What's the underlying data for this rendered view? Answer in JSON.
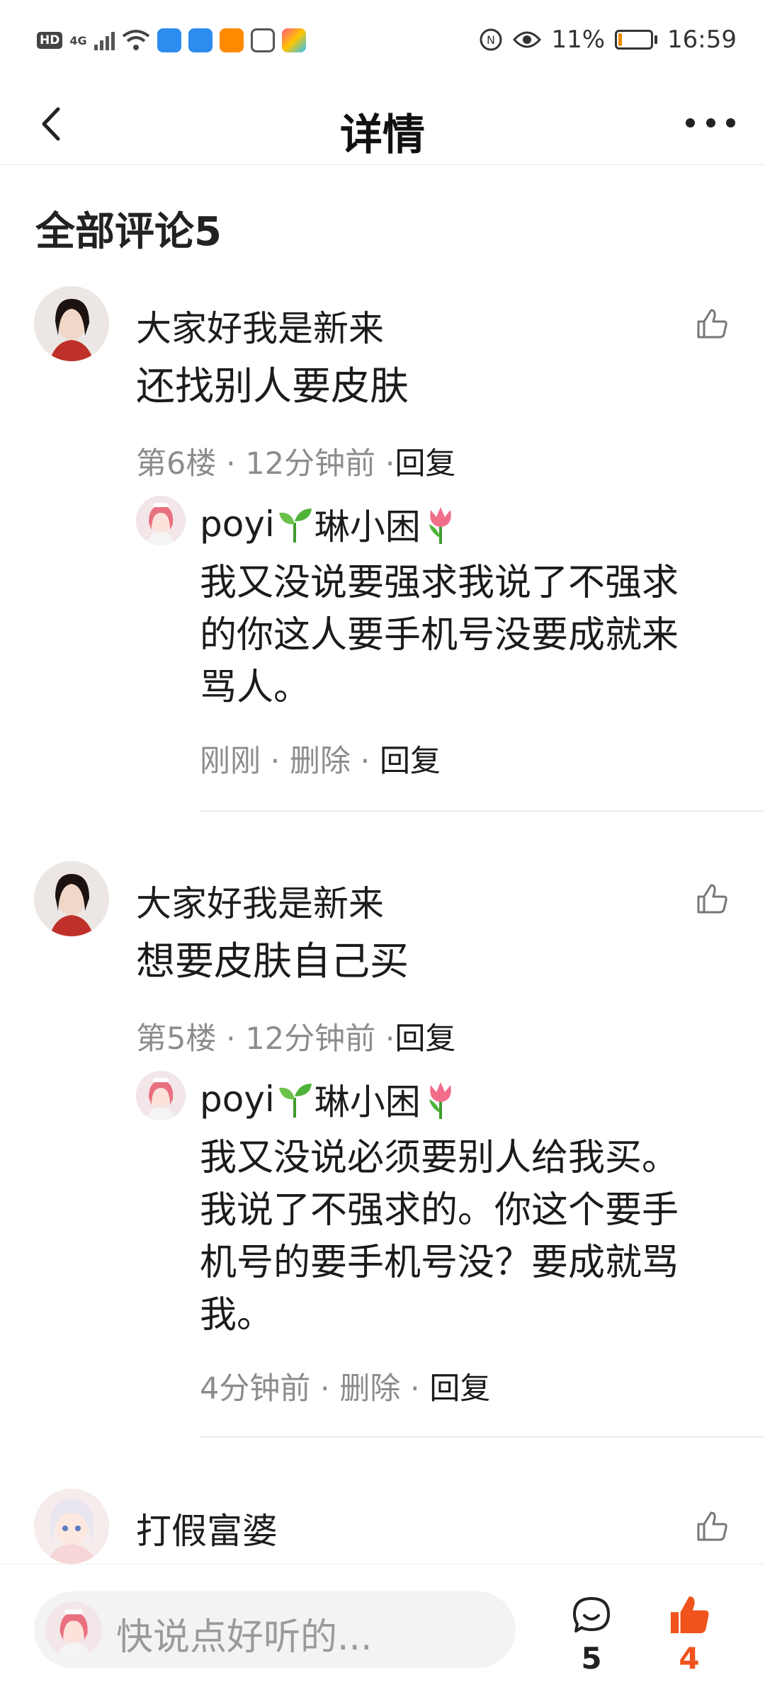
{
  "status_bar": {
    "hd": "HD",
    "network": "4G",
    "battery": "11%",
    "time": "16:59"
  },
  "nav": {
    "back_icon": "chevron-left-icon",
    "title": "详情",
    "more_icon": "more-dots-icon"
  },
  "section_title": "全部评论5",
  "comments": [
    {
      "user": "大家好我是新来",
      "text_lines": [
        "还找别人要皮肤"
      ],
      "floor": "第6楼",
      "time": "12分钟前",
      "reply_label": "回复",
      "reply": {
        "user": "poyi",
        "user_suffix": "琳小困",
        "text_lines": [
          "我又没说要强求我说了不强求",
          "的你这人要手机号没要成就来",
          "骂人。"
        ],
        "time": "刚刚",
        "delete_label": "删除",
        "reply_label": "回复"
      }
    },
    {
      "user": "大家好我是新来",
      "text_lines": [
        "想要皮肤自己买"
      ],
      "floor": "第5楼",
      "time": "12分钟前",
      "reply_label": "回复",
      "reply": {
        "user": "poyi",
        "user_suffix": "琳小困",
        "text_lines": [
          "我又没说必须要别人给我买。",
          "我说了不强求的。你这个要手",
          "机号的要手机号没？要成就骂",
          "我。"
        ],
        "time": "4分钟前",
        "delete_label": "删除",
        "reply_label": "回复"
      }
    },
    {
      "user": "打假富婆"
    }
  ],
  "bottom_bar": {
    "input_placeholder": "快说点好听的...",
    "comment_count": "5",
    "like_count": "4",
    "accent_color": "#f0531c"
  }
}
